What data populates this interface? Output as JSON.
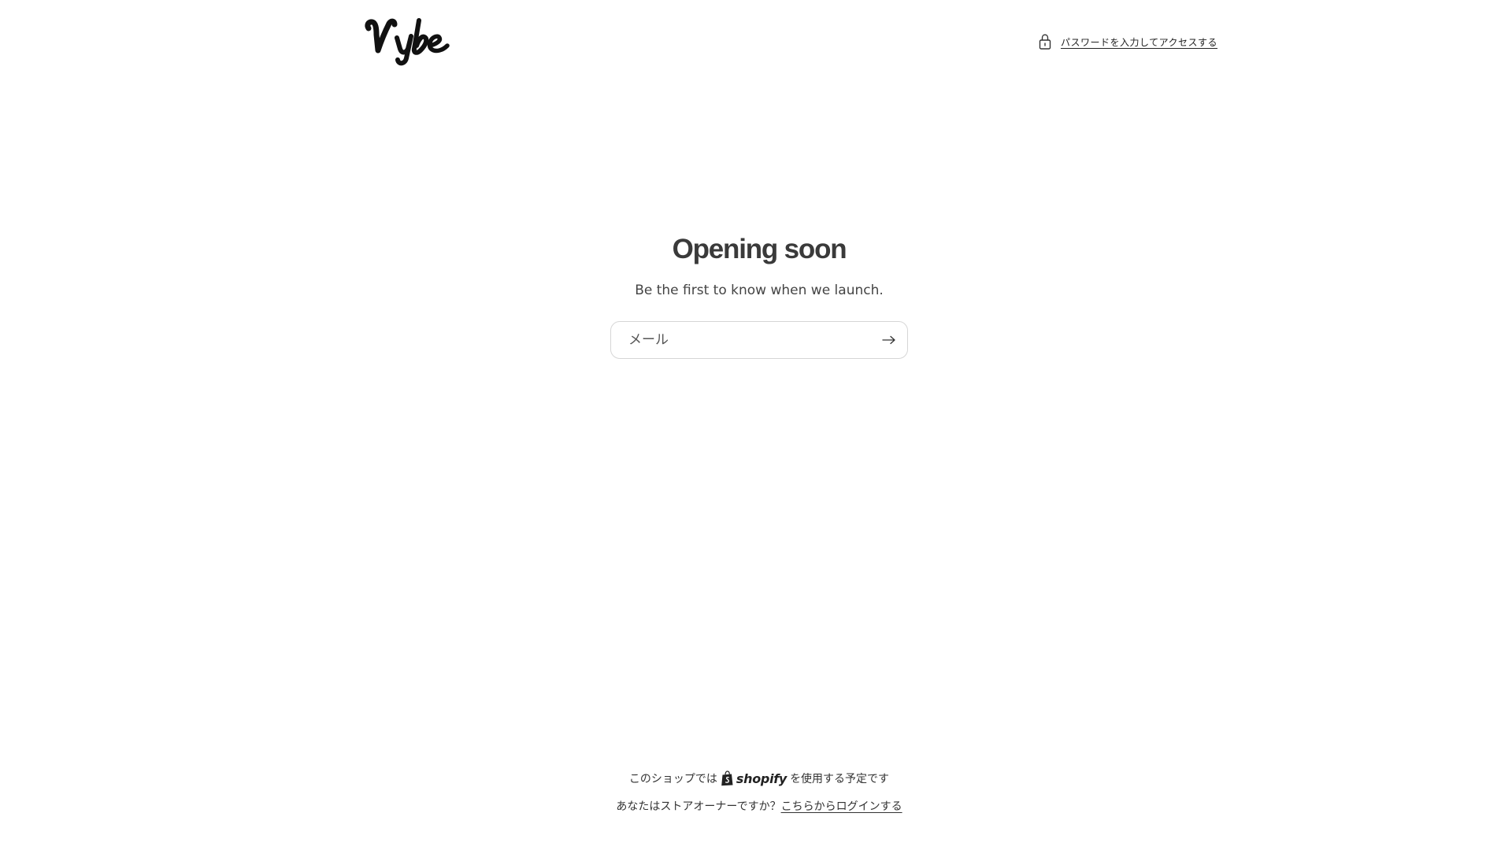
{
  "header": {
    "logo_text": "Vybe",
    "password_link_label": "パスワードを入力してアクセスする"
  },
  "main": {
    "title": "Opening soon",
    "subtitle": "Be the first to know when we launch.",
    "email": {
      "placeholder": "メール",
      "value": ""
    }
  },
  "footer": {
    "powered_prefix": "このショップでは",
    "shopify_brand": "shopify",
    "powered_suffix": "を使用する予定です",
    "owner_question": "あなたはストアオーナーですか？",
    "login_link_label": "こちらからログインする"
  },
  "colors": {
    "background": "#ffffff",
    "text": "#333333",
    "border": "#d6d6d6"
  },
  "icons": {
    "lock": "lock-icon",
    "submit": "arrow-right-icon",
    "shopify": "shopify-bag-icon"
  }
}
